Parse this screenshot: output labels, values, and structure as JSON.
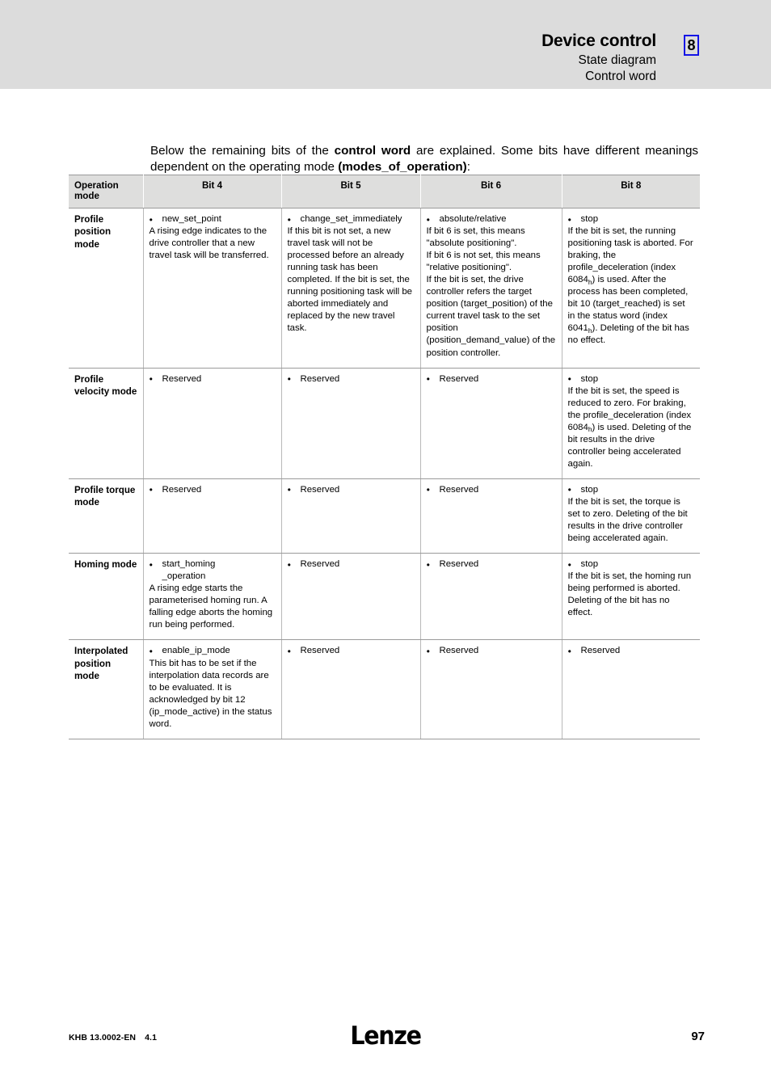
{
  "header": {
    "title": "Device control",
    "subtitle_1": "State diagram",
    "subtitle_2": "Control word",
    "chapter_marker": "8",
    "marker_border_color": "#1414e6",
    "band_color": "#dcdcdc"
  },
  "intro": {
    "part_1": "Below the remaining bits of the ",
    "bold_1": "control word",
    "part_2": " are explained. Some bits have different meanings dependent on the operating mode ",
    "bold_2": "(modes_of_operation)",
    "part_3": ":"
  },
  "table": {
    "headers": [
      "Operation mode",
      "Bit 4",
      "Bit 5",
      "Bit 6",
      "Bit 8"
    ],
    "rows": [
      {
        "mode": "Profile position mode",
        "bit4": {
          "bullet": "new_set_point",
          "body": "A rising edge indicates to the drive controller that a new travel task will be transferred."
        },
        "bit5": {
          "bullet": "change_set_immediately",
          "body": "If this bit is not set, a new travel task will not be processed before an already running task has been completed. If the bit is set, the running positioning task will be aborted immediately and replaced by the new travel task."
        },
        "bit6": {
          "bullet": "absolute/relative",
          "body_a": "If bit 6 is set, this means \"absolute positioning\".\nIf bit 6 is not set, this means \"relative positioning\".\nIf the bit is set, the drive controller refers the target position (target_position) of the current travel task to the set position (position_demand_value) of the position controller."
        },
        "bit8": {
          "bullet": "stop",
          "body_a": "If the bit is set, the running positioning task is aborted. For braking, the profile_deceleration (index 6084",
          "sub_1": "h",
          "body_b": ") is used. After the process has been completed, bit 10 (target_reached) is set in the status word (index 6041",
          "sub_2": "h",
          "body_c": "). Deleting of the bit has no effect."
        }
      },
      {
        "mode": "Profile velocity mode",
        "bit4": {
          "bullet": "Reserved",
          "body": ""
        },
        "bit5": {
          "bullet": "Reserved",
          "body": ""
        },
        "bit6": {
          "bullet": "Reserved",
          "body": ""
        },
        "bit8": {
          "bullet": "stop",
          "body_a": "If the bit is set, the speed is reduced to zero. For braking, the profile_deceleration (index 6084",
          "sub_1": "h",
          "body_b": ") is used. Deleting of the bit results in the drive controller being accelerated again."
        }
      },
      {
        "mode": "Profile torque mode",
        "bit4": {
          "bullet": "Reserved",
          "body": ""
        },
        "bit5": {
          "bullet": "Reserved",
          "body": ""
        },
        "bit6": {
          "bullet": "Reserved",
          "body": ""
        },
        "bit8": {
          "bullet": "stop",
          "body": "If the bit is set, the torque is set to zero. Deleting of the bit results in the drive controller being accelerated again."
        }
      },
      {
        "mode": "Homing mode",
        "bit4": {
          "bullet": "start_homing\n_operation",
          "body": "A rising edge starts the parameterised homing run. A falling edge aborts the homing run being performed."
        },
        "bit5": {
          "bullet": "Reserved",
          "body": ""
        },
        "bit6": {
          "bullet": "Reserved",
          "body": ""
        },
        "bit8": {
          "bullet": "stop",
          "body": "If the bit is set, the homing run being performed is aborted. Deleting of the bit has no effect."
        }
      },
      {
        "mode": "Interpolated position mode",
        "bit4": {
          "bullet": "enable_ip_mode",
          "body": "This bit has to be set if the interpolation data records are to be evaluated. It is acknowledged by bit 12 (ip_mode_active) in the status word."
        },
        "bit5": {
          "bullet": "Reserved",
          "body": ""
        },
        "bit6": {
          "bullet": "Reserved",
          "body": ""
        },
        "bit8": {
          "bullet": "Reserved",
          "body": ""
        }
      }
    ]
  },
  "footer": {
    "doc_id": "KHB 13.0002-EN",
    "revision": "4.1",
    "logo": "Lenze",
    "page_number": "97"
  }
}
